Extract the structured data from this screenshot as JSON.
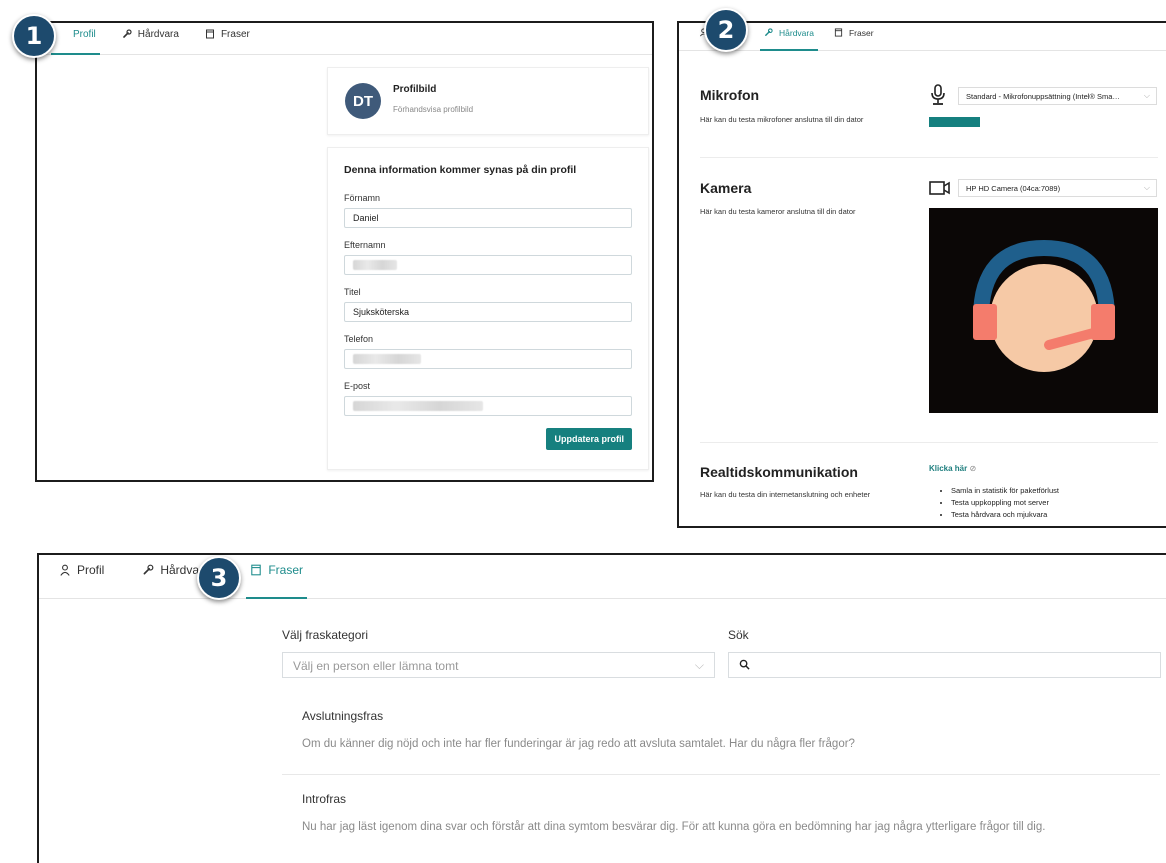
{
  "badges": [
    "1",
    "2",
    "3"
  ],
  "tabs": [
    {
      "label": "Profil",
      "icon": "user-icon"
    },
    {
      "label": "Hårdvara",
      "icon": "wrench-icon"
    },
    {
      "label": "Fraser",
      "icon": "note-icon"
    }
  ],
  "profile": {
    "avatar_initials": "DT",
    "picture_title": "Profilbild",
    "picture_subtitle": "Förhandsvisa profilbild",
    "info_heading": "Denna information kommer synas på din profil",
    "fields": {
      "first_name": {
        "label": "Förnamn",
        "value": "Daniel"
      },
      "last_name": {
        "label": "Efternamn"
      },
      "title": {
        "label": "Titel",
        "value": "Sjuksköterska"
      },
      "phone": {
        "label": "Telefon"
      },
      "email": {
        "label": "E-post"
      }
    },
    "update_button": "Uppdatera profil"
  },
  "hardware": {
    "mic": {
      "title": "Mikrofon",
      "subtitle": "Här kan du testa mikrofoner anslutna till din dator",
      "selected": "Standard - Mikrofonuppsättning (Intel® Sma…",
      "level_color": "#15807f"
    },
    "camera": {
      "title": "Kamera",
      "subtitle": "Här kan du testa kameror anslutna till din dator",
      "selected": "HP HD Camera (04ca:7089)"
    },
    "rtc": {
      "title": "Realtidskommunikation",
      "subtitle": "Här kan du testa din internetanslutning och enheter",
      "link": "Klicka här",
      "bullets": [
        "Samla in statistik för paketförlust",
        "Testa uppkoppling mot server",
        "Testa hårdvara och mjukvara"
      ]
    }
  },
  "phrases": {
    "category_label": "Välj fraskategori",
    "category_placeholder": "Välj en person eller lämna tomt",
    "search_label": "Sök",
    "items": [
      {
        "title": "Avslutningsfras",
        "text": "Om du känner dig nöjd och inte har fler funderingar är jag redo att avsluta samtalet. Har du några fler frågor?"
      },
      {
        "title": "Introfras",
        "text": "Nu har jag läst igenom dina svar och förstår att dina symtom besvärar dig. För att kunna göra en bedömning har jag några ytterligare frågor till dig."
      }
    ]
  },
  "colors": {
    "accent": "#1e8c8c",
    "badge": "#1d4a6d",
    "avatar": "#3f5a7a"
  }
}
